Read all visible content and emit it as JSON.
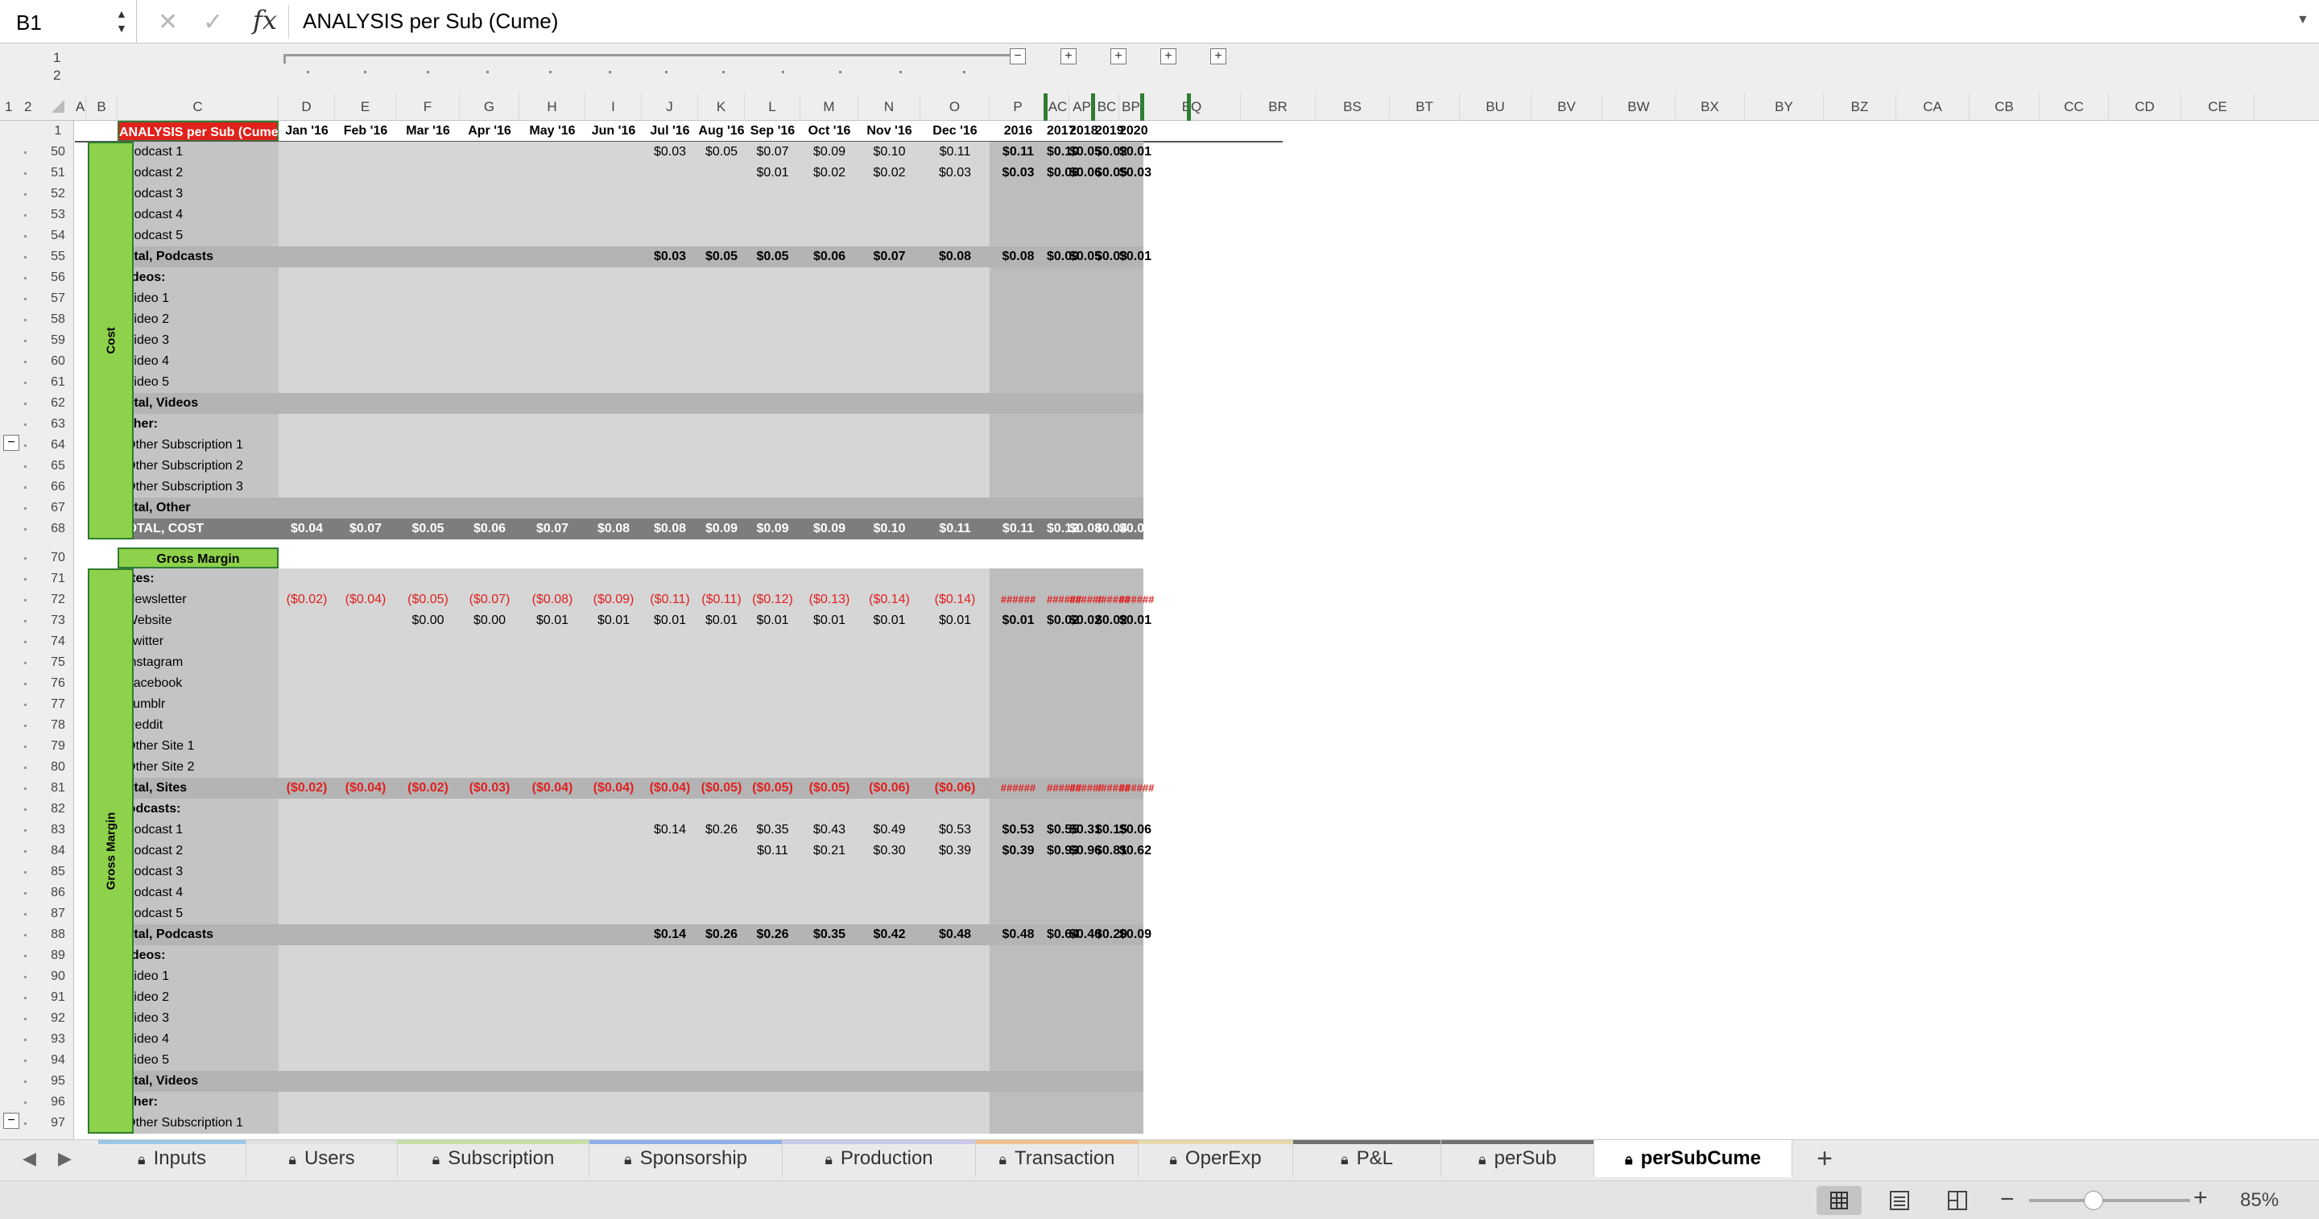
{
  "formula_bar": {
    "cell_ref": "B1",
    "fx": "fx",
    "content": "ANALYSIS per Sub (Cume)"
  },
  "outline": {
    "levels": [
      "1",
      "2"
    ],
    "col_levels": [
      "1",
      "2"
    ]
  },
  "columns": [
    {
      "letter": "A",
      "header": ""
    },
    {
      "letter": "B",
      "header": ""
    },
    {
      "letter": "C",
      "header": "ANALYSIS per Sub (Cume)"
    },
    {
      "letter": "D",
      "header": "Jan '16"
    },
    {
      "letter": "E",
      "header": "Feb '16"
    },
    {
      "letter": "F",
      "header": "Mar '16"
    },
    {
      "letter": "G",
      "header": "Apr '16"
    },
    {
      "letter": "H",
      "header": "May '16"
    },
    {
      "letter": "I",
      "header": "Jun '16"
    },
    {
      "letter": "J",
      "header": "Jul '16"
    },
    {
      "letter": "K",
      "header": "Aug '16"
    },
    {
      "letter": "L",
      "header": "Sep '16"
    },
    {
      "letter": "M",
      "header": "Oct '16"
    },
    {
      "letter": "N",
      "header": "Nov '16"
    },
    {
      "letter": "O",
      "header": "Dec '16"
    },
    {
      "letter": "P",
      "header": "2016"
    },
    {
      "letter": "AC",
      "header": "2017"
    },
    {
      "letter": "AP",
      "header": "2018"
    },
    {
      "letter": "BC",
      "header": "2019"
    },
    {
      "letter": "BP",
      "header": "2020"
    },
    {
      "letter": "BQ",
      "header": ""
    },
    {
      "letter": "BR",
      "header": ""
    },
    {
      "letter": "BS",
      "header": ""
    },
    {
      "letter": "BT",
      "header": ""
    },
    {
      "letter": "BU",
      "header": ""
    },
    {
      "letter": "BV",
      "header": ""
    },
    {
      "letter": "BW",
      "header": ""
    },
    {
      "letter": "BX",
      "header": ""
    },
    {
      "letter": "BY",
      "header": ""
    },
    {
      "letter": "BZ",
      "header": ""
    },
    {
      "letter": "CA",
      "header": ""
    },
    {
      "letter": "CB",
      "header": ""
    },
    {
      "letter": "CC",
      "header": ""
    },
    {
      "letter": "CD",
      "header": ""
    },
    {
      "letter": "CE",
      "header": ""
    }
  ],
  "section_labels": {
    "cost": "Cost",
    "gross_margin": "Gross Margin"
  },
  "rows": [
    {
      "n": "50",
      "label": "Podcast 1",
      "indent": true,
      "style": "",
      "vals": [
        "",
        "",
        "",
        "",
        "",
        "",
        "$0.03",
        "$0.05",
        "$0.07",
        "$0.09",
        "$0.10",
        "$0.11",
        "$0.11",
        "$0.10",
        "$0.05",
        "$0.02",
        "$0.01"
      ]
    },
    {
      "n": "51",
      "label": "Podcast 2",
      "indent": true,
      "style": "",
      "vals": [
        "",
        "",
        "",
        "",
        "",
        "",
        "",
        "",
        "$0.01",
        "$0.02",
        "$0.02",
        "$0.03",
        "$0.03",
        "$0.06",
        "$0.06",
        "$0.05",
        "$0.03"
      ]
    },
    {
      "n": "52",
      "label": "Podcast 3",
      "indent": true,
      "style": "",
      "vals": []
    },
    {
      "n": "53",
      "label": "Podcast 4",
      "indent": true,
      "style": "",
      "vals": []
    },
    {
      "n": "54",
      "label": "Podcast 5",
      "indent": true,
      "style": "",
      "vals": []
    },
    {
      "n": "55",
      "label": "Total, Podcasts",
      "indent": false,
      "style": "total",
      "vals": [
        "",
        "",
        "",
        "",
        "",
        "",
        "$0.03",
        "$0.05",
        "$0.05",
        "$0.06",
        "$0.07",
        "$0.08",
        "$0.08",
        "$0.09",
        "$0.05",
        "$0.03",
        "$0.01"
      ]
    },
    {
      "n": "56",
      "label": "Videos:",
      "indent": false,
      "style": "head",
      "vals": []
    },
    {
      "n": "57",
      "label": "Video 1",
      "indent": true,
      "style": "",
      "vals": []
    },
    {
      "n": "58",
      "label": "Video 2",
      "indent": true,
      "style": "",
      "vals": []
    },
    {
      "n": "59",
      "label": "Video 3",
      "indent": true,
      "style": "",
      "vals": []
    },
    {
      "n": "60",
      "label": "Video 4",
      "indent": true,
      "style": "",
      "vals": []
    },
    {
      "n": "61",
      "label": "Video 5",
      "indent": true,
      "style": "",
      "vals": []
    },
    {
      "n": "62",
      "label": "Total, Videos",
      "indent": false,
      "style": "total",
      "vals": []
    },
    {
      "n": "63",
      "label": "Other:",
      "indent": false,
      "style": "head",
      "vals": []
    },
    {
      "n": "64",
      "label": "Other Subscription 1",
      "indent": true,
      "style": "",
      "vals": []
    },
    {
      "n": "65",
      "label": "Other Subscription 2",
      "indent": true,
      "style": "",
      "vals": []
    },
    {
      "n": "66",
      "label": "Other Subscription 3",
      "indent": true,
      "style": "",
      "vals": []
    },
    {
      "n": "67",
      "label": "Total, Other",
      "indent": false,
      "style": "total",
      "vals": []
    },
    {
      "n": "68",
      "label": "TOTAL, COST",
      "indent": false,
      "style": "grand",
      "vals": [
        "$0.04",
        "$0.07",
        "$0.05",
        "$0.06",
        "$0.07",
        "$0.08",
        "$0.08",
        "$0.09",
        "$0.09",
        "$0.09",
        "$0.10",
        "$0.11",
        "$0.11",
        "$0.12",
        "$0.08",
        "$0.04",
        "$0.02"
      ]
    },
    {
      "n": "70",
      "label": "Gross Margin",
      "indent": false,
      "style": "gmhead",
      "vals": []
    },
    {
      "n": "71",
      "label": "Sites:",
      "indent": false,
      "style": "head",
      "vals": []
    },
    {
      "n": "72",
      "label": "Newsletter",
      "indent": true,
      "style": "neg",
      "vals": [
        "($0.02)",
        "($0.04)",
        "($0.05)",
        "($0.07)",
        "($0.08)",
        "($0.09)",
        "($0.11)",
        "($0.11)",
        "($0.12)",
        "($0.13)",
        "($0.14)",
        "($0.14)",
        "######",
        "######",
        "######",
        "######",
        "######"
      ]
    },
    {
      "n": "73",
      "label": "Website",
      "indent": true,
      "style": "",
      "vals": [
        "",
        "",
        "$0.00",
        "$0.00",
        "$0.01",
        "$0.01",
        "$0.01",
        "$0.01",
        "$0.01",
        "$0.01",
        "$0.01",
        "$0.01",
        "$0.01",
        "$0.02",
        "$0.02",
        "$0.02",
        "$0.01"
      ]
    },
    {
      "n": "74",
      "label": "Twitter",
      "indent": true,
      "style": "",
      "vals": []
    },
    {
      "n": "75",
      "label": "Instagram",
      "indent": true,
      "style": "",
      "vals": []
    },
    {
      "n": "76",
      "label": "Facebook",
      "indent": true,
      "style": "",
      "vals": []
    },
    {
      "n": "77",
      "label": "Tumblr",
      "indent": true,
      "style": "",
      "vals": []
    },
    {
      "n": "78",
      "label": "Reddit",
      "indent": true,
      "style": "",
      "vals": []
    },
    {
      "n": "79",
      "label": "Other Site 1",
      "indent": true,
      "style": "",
      "vals": []
    },
    {
      "n": "80",
      "label": "Other Site 2",
      "indent": true,
      "style": "",
      "vals": []
    },
    {
      "n": "81",
      "label": "Total, Sites",
      "indent": false,
      "style": "total neg",
      "vals": [
        "($0.02)",
        "($0.04)",
        "($0.02)",
        "($0.03)",
        "($0.04)",
        "($0.04)",
        "($0.04)",
        "($0.05)",
        "($0.05)",
        "($0.05)",
        "($0.06)",
        "($0.06)",
        "######",
        "######",
        "######",
        "######",
        "######"
      ]
    },
    {
      "n": "82",
      "label": "Podcasts:",
      "indent": false,
      "style": "head",
      "vals": []
    },
    {
      "n": "83",
      "label": "Podcast 1",
      "indent": true,
      "style": "",
      "vals": [
        "",
        "",
        "",
        "",
        "",
        "",
        "$0.14",
        "$0.26",
        "$0.35",
        "$0.43",
        "$0.49",
        "$0.53",
        "$0.53",
        "$0.55",
        "$0.31",
        "$0.15",
        "$0.06"
      ]
    },
    {
      "n": "84",
      "label": "Podcast 2",
      "indent": true,
      "style": "",
      "vals": [
        "",
        "",
        "",
        "",
        "",
        "",
        "",
        "",
        "$0.11",
        "$0.21",
        "$0.30",
        "$0.39",
        "$0.39",
        "$0.93",
        "$0.96",
        "$0.81",
        "$0.62"
      ]
    },
    {
      "n": "85",
      "label": "Podcast 3",
      "indent": true,
      "style": "",
      "vals": []
    },
    {
      "n": "86",
      "label": "Podcast 4",
      "indent": true,
      "style": "",
      "vals": []
    },
    {
      "n": "87",
      "label": "Podcast 5",
      "indent": true,
      "style": "",
      "vals": []
    },
    {
      "n": "88",
      "label": "Total, Podcasts",
      "indent": false,
      "style": "total",
      "vals": [
        "",
        "",
        "",
        "",
        "",
        "",
        "$0.14",
        "$0.26",
        "$0.26",
        "$0.35",
        "$0.42",
        "$0.48",
        "$0.48",
        "$0.64",
        "$0.40",
        "$0.20",
        "$0.09"
      ]
    },
    {
      "n": "89",
      "label": "Videos:",
      "indent": false,
      "style": "head",
      "vals": []
    },
    {
      "n": "90",
      "label": "Video 1",
      "indent": true,
      "style": "",
      "vals": []
    },
    {
      "n": "91",
      "label": "Video 2",
      "indent": true,
      "style": "",
      "vals": []
    },
    {
      "n": "92",
      "label": "Video 3",
      "indent": true,
      "style": "",
      "vals": []
    },
    {
      "n": "93",
      "label": "Video 4",
      "indent": true,
      "style": "",
      "vals": []
    },
    {
      "n": "94",
      "label": "Video 5",
      "indent": true,
      "style": "",
      "vals": []
    },
    {
      "n": "95",
      "label": "Total, Videos",
      "indent": false,
      "style": "total",
      "vals": []
    },
    {
      "n": "96",
      "label": "Other:",
      "indent": false,
      "style": "head",
      "vals": []
    },
    {
      "n": "97",
      "label": "Other Subscription 1",
      "indent": true,
      "style": "",
      "vals": []
    }
  ],
  "header_row_number": "1",
  "tabs": [
    {
      "label": "Inputs",
      "color": "#9cc8e8",
      "active": false
    },
    {
      "label": "Users",
      "color": "#e0e0e0",
      "active": false
    },
    {
      "label": "Subscription",
      "color": "#c8e0a8",
      "active": false
    },
    {
      "label": "Sponsorship",
      "color": "#8eb0e8",
      "active": false
    },
    {
      "label": "Production",
      "color": "#c8c8e8",
      "active": false
    },
    {
      "label": "Transaction",
      "color": "#f0c090",
      "active": false
    },
    {
      "label": "OperExp",
      "color": "#e8d8a8",
      "active": false
    },
    {
      "label": "P&L",
      "color": "#707070",
      "active": false
    },
    {
      "label": "perSub",
      "color": "#707070",
      "active": false
    },
    {
      "label": "perSubCume",
      "color": "#ffffff",
      "active": true
    }
  ],
  "add_sheet": "+",
  "zoom": "85%",
  "colors": {
    "title_red": "#e0221c",
    "green": "#8ed14a",
    "shaded": "#d6d6d6",
    "label_col": "#c4c4c4",
    "annual": "#bdbdbd",
    "total_band": "#b4b4b4",
    "grand_band": "#7d7d7d",
    "neg": "#e02020"
  }
}
